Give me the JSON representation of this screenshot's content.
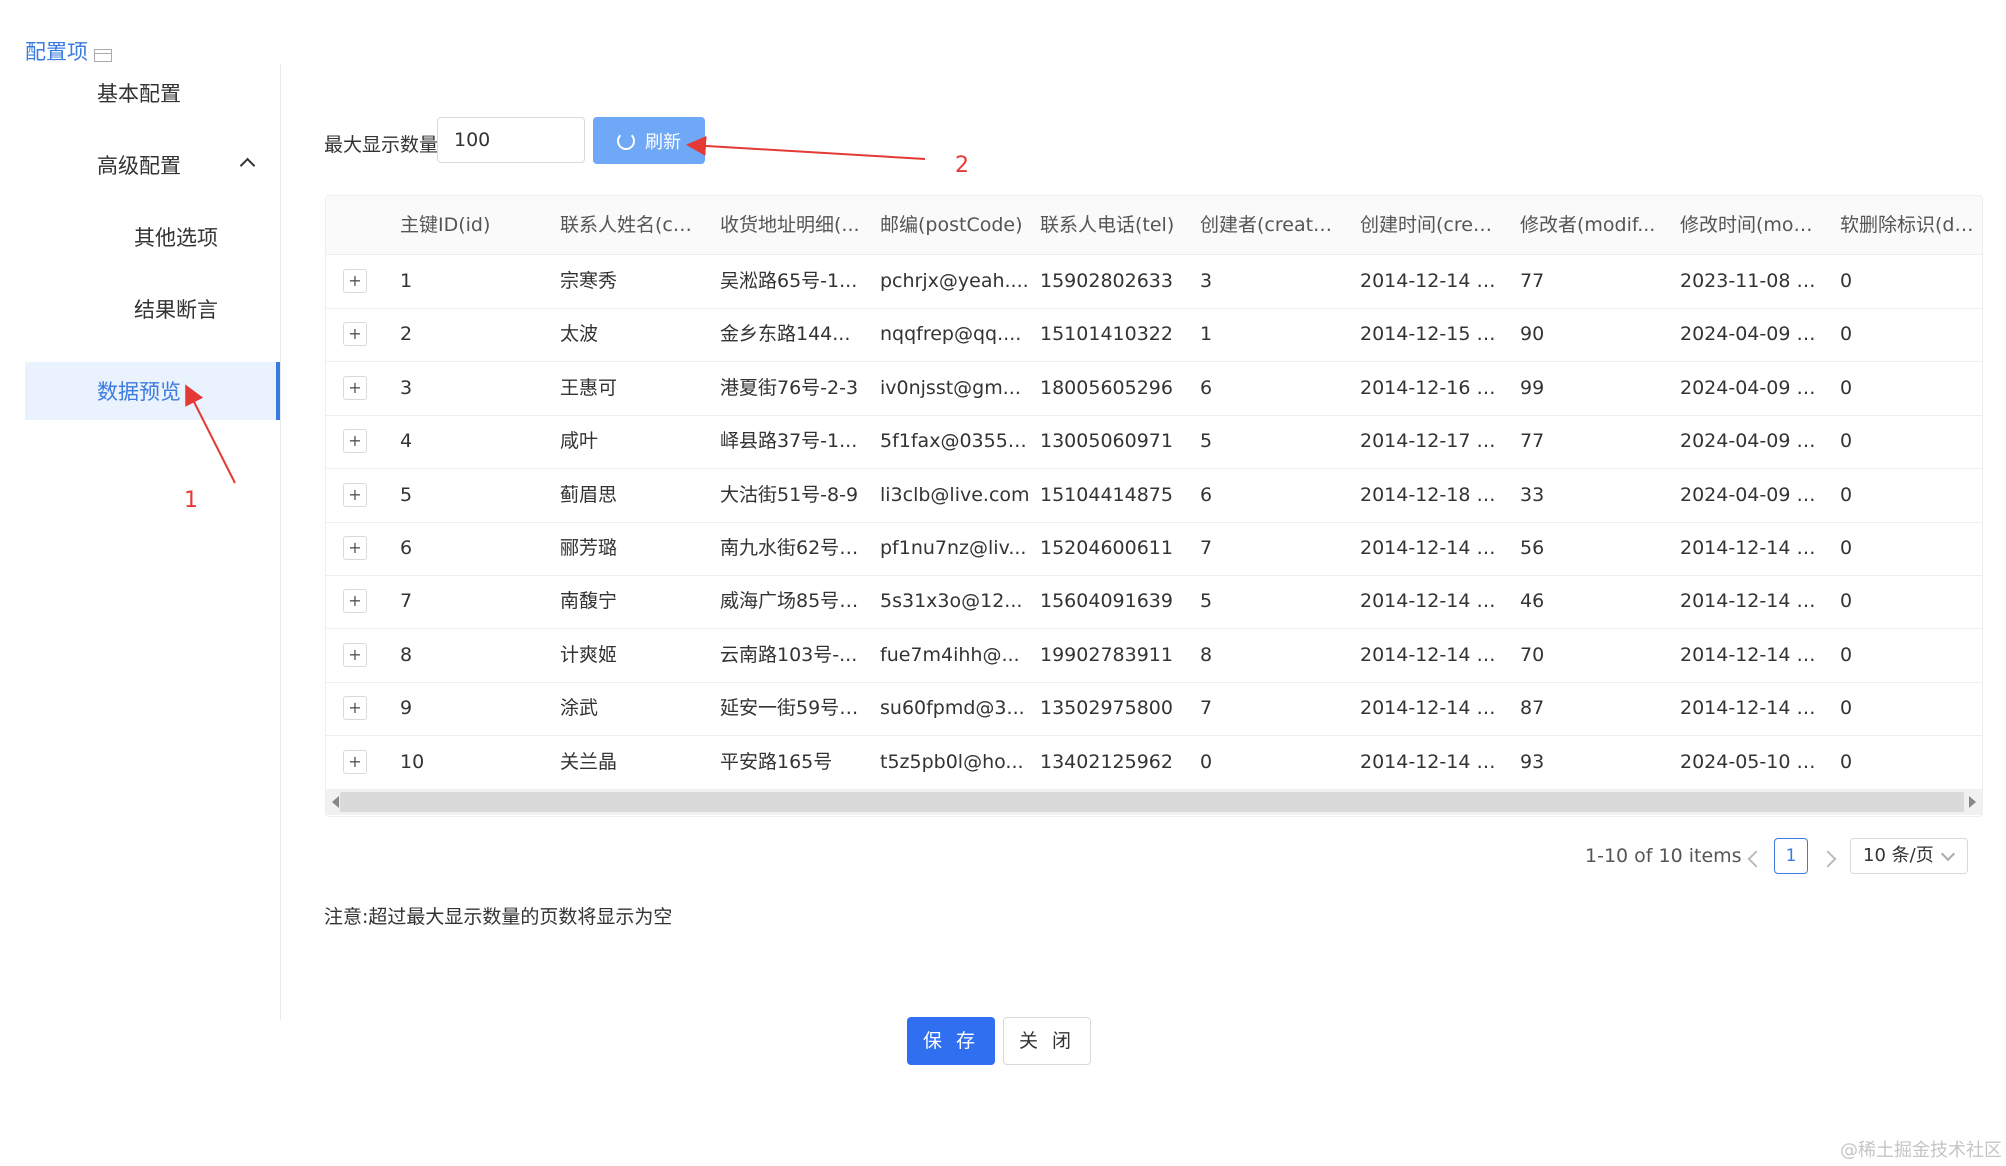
{
  "header": {
    "title": "配置项"
  },
  "sidebar": {
    "items": [
      {
        "label": "基本配置"
      },
      {
        "label": "高级配置"
      },
      {
        "label": "其他选项"
      },
      {
        "label": "结果断言"
      },
      {
        "label": "数据预览"
      }
    ]
  },
  "toolbar": {
    "max_label": "最大显示数量:",
    "max_value": "100",
    "refresh_label": "刷新"
  },
  "table": {
    "headers": [
      "主键ID(id)",
      "联系人姓名(co...",
      "收货地址明细(...",
      "邮编(postCode)",
      "联系人电话(tel)",
      "创建者(create...",
      "创建时间(creat...",
      "修改者(modif...",
      "修改时间(mod...",
      "软删除标识(de..."
    ],
    "expand_symbol": "+",
    "rows": [
      [
        "1",
        "宗寒秀",
        "吴淞路65号-1...",
        "pchrjx@yeah....",
        "15902802633",
        "3",
        "2014-12-14 1...",
        "77",
        "2023-11-08 1...",
        "0"
      ],
      [
        "2",
        "太波",
        "金乡东路144...",
        "nqqfrep@qq....",
        "15101410322",
        "1",
        "2014-12-15 1...",
        "90",
        "2024-04-09 1...",
        "0"
      ],
      [
        "3",
        "王惠可",
        "港夏街76号-2-3",
        "iv0njsst@gm...",
        "18005605296",
        "6",
        "2014-12-16 1...",
        "99",
        "2024-04-09 1...",
        "0"
      ],
      [
        "4",
        "咸叶",
        "峄县路37号-1...",
        "5f1fax@0355....",
        "13005060971",
        "5",
        "2014-12-17 1...",
        "77",
        "2024-04-09 1...",
        "0"
      ],
      [
        "5",
        "蓟眉思",
        "大沽街51号-8-9",
        "li3clb@live.com",
        "15104414875",
        "6",
        "2014-12-18 1...",
        "33",
        "2024-04-09 1...",
        "0"
      ],
      [
        "6",
        "郦芳璐",
        "南九水街62号-...",
        "pf1nu7nz@liv...",
        "15204600611",
        "7",
        "2014-12-14 1...",
        "56",
        "2014-12-14 1...",
        "0"
      ],
      [
        "7",
        "南馥宁",
        "威海广场85号-...",
        "5s31x3o@12...",
        "15604091639",
        "5",
        "2014-12-14 1...",
        "46",
        "2014-12-14 1...",
        "0"
      ],
      [
        "8",
        "计爽姬",
        "云南路103号-...",
        "fue7m4ihh@...",
        "19902783911",
        "8",
        "2014-12-14 1...",
        "70",
        "2014-12-14 1...",
        "0"
      ],
      [
        "9",
        "涂武",
        "延安一街59号-...",
        "su60fpmd@3...",
        "13502975800",
        "7",
        "2014-12-14 1...",
        "87",
        "2014-12-14 1...",
        "0"
      ],
      [
        "10",
        "关兰晶",
        "平安路165号",
        "t5z5pb0l@ho...",
        "13402125962",
        "0",
        "2014-12-14 1...",
        "93",
        "2024-05-10 1...",
        "0"
      ]
    ]
  },
  "pagination": {
    "total_text": "1-10 of 10 items",
    "current_page": "1",
    "page_size": "10 条/页"
  },
  "note": "注意:超过最大显示数量的页数将显示为空",
  "footer": {
    "save_label": "保 存",
    "close_label": "关 闭"
  },
  "annotations": {
    "marker_1": "1",
    "marker_2": "2"
  },
  "watermark": "@稀土掘金技术社区",
  "colors": {
    "accent": "#3a7be0",
    "primary_button": "#2f6ff0",
    "annotation": "#e53935"
  }
}
